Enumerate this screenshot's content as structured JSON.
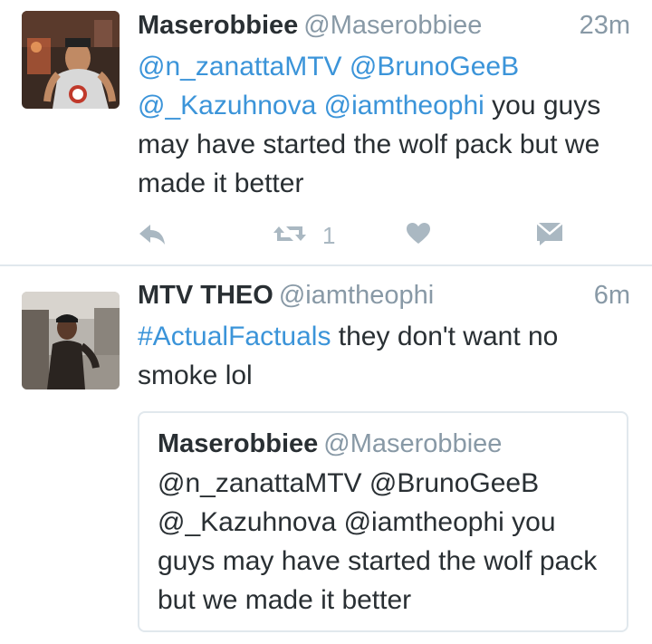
{
  "tweets": [
    {
      "name": "Maserobbiee",
      "handle": "@Maserobbiee",
      "time": "23m",
      "text_parts": [
        {
          "text": "@n_zanattaMTV",
          "type": "mention"
        },
        {
          "text": " ",
          "type": "plain"
        },
        {
          "text": "@BrunoGeeB",
          "type": "mention"
        },
        {
          "text": " ",
          "type": "plain"
        },
        {
          "text": "@_Kazuhnova",
          "type": "mention"
        },
        {
          "text": " ",
          "type": "plain"
        },
        {
          "text": "@iamtheophi",
          "type": "mention"
        },
        {
          "text": "  you guys may have started the wolf pack but we made it better",
          "type": "plain"
        }
      ],
      "retweet_count": "1",
      "action_icons": [
        "reply-icon",
        "retweet-icon",
        "heart-icon",
        "message-icon"
      ]
    },
    {
      "name": "MTV THEO",
      "handle": "@iamtheophi",
      "time": "6m",
      "text_parts": [
        {
          "text": "#ActualFactuals",
          "type": "hashtag"
        },
        {
          "text": " they don't want no smoke lol",
          "type": "plain"
        }
      ],
      "quote": {
        "name": "Maserobbiee",
        "handle": "@Maserobbiee",
        "text": "@n_zanattaMTV @BrunoGeeB @_Kazuhnova @iamtheophi  you guys may have started the wolf pack but we made it better"
      }
    }
  ],
  "colors": {
    "link": "#3b94d9",
    "text": "#292f33",
    "muted": "#8899a6",
    "icon": "#aab8c2",
    "divider": "#e1e8ed"
  }
}
